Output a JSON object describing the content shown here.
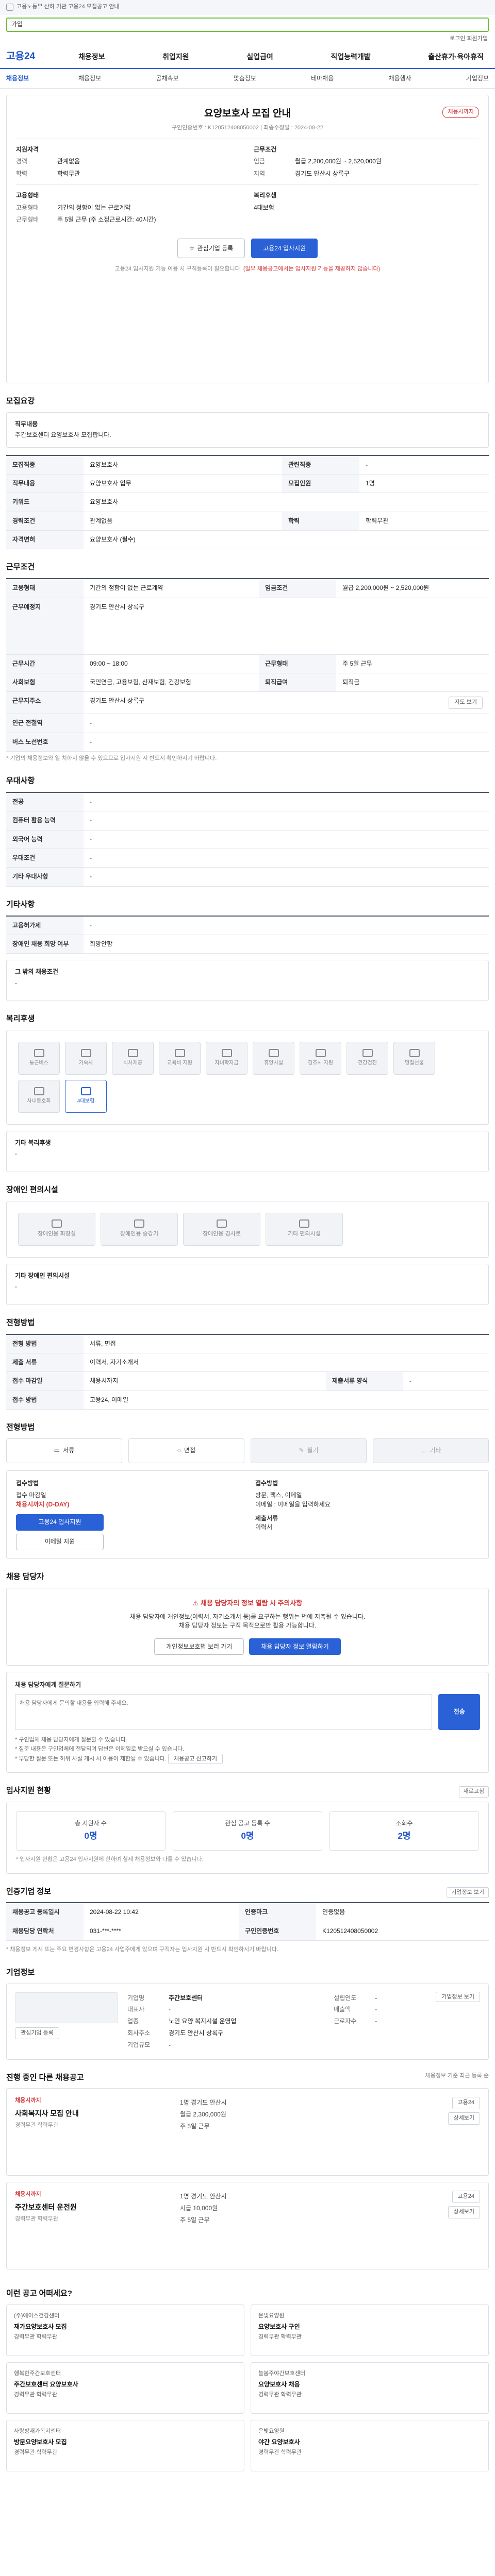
{
  "util": {
    "text": "고용노동부 산하 기관 고용24 모집공고 안내"
  },
  "search": {
    "keyword": "가입"
  },
  "login": {
    "links": "로그인  회원가입"
  },
  "gnb": {
    "logo": "고용24",
    "items": [
      "채용정보",
      "취업지원",
      "실업급여",
      "직업능력개발",
      "출산휴가·육아휴직"
    ]
  },
  "subnav": {
    "current": "채용정보",
    "items": [
      "채용정보",
      "공채속보",
      "맞춤정보",
      "테마채용",
      "채용행사",
      "기업정보"
    ]
  },
  "hero": {
    "title": "요양보호사 모집 안내",
    "badge": "채용시까지",
    "meta": "구인인증번호 : K120512408050002  |  최종수정일 : 2024-08-22",
    "recruit_head": "지원자격",
    "company_head": "근무조건",
    "left": [
      {
        "k": "경력",
        "v": "관계없음"
      },
      {
        "k": "학력",
        "v": "학력무관"
      }
    ],
    "right": [
      {
        "k": "임금",
        "v": "월급 2,200,000원 ~ 2,520,000원"
      },
      {
        "k": "지역",
        "v": "경기도 안산시 상록구"
      }
    ],
    "form_head": "고용형태",
    "form_items": [
      {
        "k": "고용형태",
        "v": "기간의 정함이 없는 근로계약"
      },
      {
        "k": "근무형태",
        "v": "주 5일 근무 (주 소정근로시간: 40시간)"
      }
    ],
    "right2_head": "복리후생",
    "right2_v": "4대보험",
    "btn_interest": "관심기업 등록",
    "btn_apply": "고용24 입사지원",
    "note": "고용24 입사지원 기능 이용 시 구직등록이 필요합니다.",
    "note_red": "(일부 채용공고에서는 입사지원 기능을 제공하지 않습니다)"
  },
  "duty": {
    "title": "모집요강",
    "label": "직무내용",
    "text": "주간보호센터 요양보호사 모집합니다."
  },
  "recruit_table": {
    "rows": [
      {
        "k": "모집직종",
        "v": "요양보호사",
        "k2": "관련직종",
        "v2": "-"
      },
      {
        "k": "직무내용",
        "v": "요양보호사 업무",
        "k2": "모집인원",
        "v2": "1명"
      },
      {
        "k": "키워드",
        "v": "요양보호사",
        "k2": "",
        "v2": ""
      },
      {
        "k": "경력조건",
        "v": "관계없음",
        "k2": "학력",
        "v2": "학력무관"
      },
      {
        "k": "자격면허",
        "v": "요양보호사 (필수)",
        "k2": "",
        "v2": ""
      }
    ]
  },
  "work": {
    "title": "근무조건",
    "rows": [
      {
        "k": "고용형태",
        "v": "기간의 정함이 없는 근로계약",
        "k2": "임금조건",
        "v2": "월급 2,200,000원 ~ 2,520,000원"
      },
      {
        "k": "근무예정지",
        "v": "경기도 안산시 상록구",
        "k2": "",
        "v2": ""
      },
      {
        "k": "근무시간",
        "v": "09:00 ~ 18:00",
        "k2": "근무형태",
        "v2": "주 5일 근무"
      },
      {
        "k": "사회보험",
        "v": "국민연금, 고용보험, 산재보험, 건강보험",
        "k2": "퇴직급여",
        "v2": "퇴직금"
      },
      {
        "k": "근무지주소",
        "v": "경기도 안산시 상록구",
        "k2": "",
        "v2": ""
      },
      {
        "k": "인근 전철역",
        "v": "-",
        "k2": "",
        "v2": ""
      },
      {
        "k": "버스 노선번호",
        "v": "-",
        "k2": "",
        "v2": ""
      }
    ],
    "map_btn": "지도 보기",
    "footnote": "* 기업의 채용정보와 일 치하지 않을 수 있으므로 입사지원 시 반드시 확인하시기 바랍니다."
  },
  "disability": {
    "title": "우대사항",
    "rows": [
      {
        "k": "전공",
        "v": "-"
      },
      {
        "k": "컴퓨터 활용 능력",
        "v": "-"
      },
      {
        "k": "외국어 능력",
        "v": "-"
      },
      {
        "k": "우대조건",
        "v": "-"
      },
      {
        "k": "기타 우대사항",
        "v": "-"
      }
    ]
  },
  "etc": {
    "title": "기타사항",
    "rows": [
      {
        "k": "고용허가제",
        "v": "-"
      },
      {
        "k": "장애인 채용 희망 여부",
        "v": "희망안함"
      }
    ],
    "extra_label": "그 밖의 채용조건",
    "extra_v": "-"
  },
  "welfare": {
    "title": "복리후생",
    "tags": [
      "통근버스",
      "기숙사",
      "식사제공",
      "교육비 지원",
      "자녀학자금",
      "휴양시설",
      "경조사 지원",
      "건강검진",
      "명절선물",
      "사내동호회"
    ],
    "on": "4대보험",
    "extra_label": "기타 복리후생",
    "extra_v": "-"
  },
  "disab_env": {
    "title": "장애인 편의시설",
    "tags": [
      "장애인용 화장실",
      "장애인용 승강기",
      "장애인용 경사로",
      "기타 편의시설"
    ],
    "extra_label": "기타 장애인 편의시설",
    "extra_v": "-"
  },
  "process": {
    "title": "전형방법",
    "rows": [
      {
        "k": "전형 방법",
        "v": "서류, 면접"
      },
      {
        "k": "제출 서류",
        "v": "이력서, 자기소개서"
      },
      {
        "k": "접수 마감일",
        "v": "채용시까지",
        "k2": "제출서류 양식",
        "v2": "-"
      },
      {
        "k": "접수 방법",
        "v": "고용24, 이메일",
        "k2": "",
        "v2": ""
      }
    ]
  },
  "methods": {
    "title": "전형방법",
    "items": [
      "서류",
      "면접",
      "필기",
      "기타"
    ]
  },
  "apply": {
    "left_head": "접수방법",
    "deadline_label": "접수 마감일",
    "deadline": "채용시까지 (D-DAY)",
    "apply_btn": "고용24 입사지원",
    "email_btn": "이메일 지원",
    "right_head": "접수방법",
    "right_lines": [
      "방문, 팩스, 이메일",
      "이메일 : 이메일을 입력하세요",
      "제출서류",
      "이력서"
    ]
  },
  "qa": {
    "title": "채용 담당자",
    "warn": "채용 담당자의 정보 열람 시 주의사항",
    "text1": "채용 담당자에 개인정보(이력서, 자기소개서 등)를 요구하는 행위는 법에 저촉될 수 있습니다.",
    "text2": "채용 담당자 정보는 구직 목적으로만 활용 가능합니다.",
    "btn_left": "개인정보보호법 보러 가기",
    "btn_right": "채용 담당자 정보 열람하기",
    "input_label": "채용 담당자에게 질문하기",
    "input_ph": "채용 담당자에게 문의할 내용을 입력해 주세요.",
    "send": "전송",
    "bullets": [
      "* 구인업체 채용 담당자에게 질문할 수 있습니다.",
      "* 질문 내용은 구인업체에 전달되며 답변은 이메일로 받으실 수 있습니다.",
      "* 부당한 질문 또는 허위 사실 게시 시 이용이 제한될 수 있습니다."
    ],
    "report_btn": "채용공고 신고하기"
  },
  "stats": {
    "title": "입사지원 현황",
    "more": "새로고침",
    "items": [
      {
        "label": "총 지원자 수",
        "value": "0명"
      },
      {
        "label": "관심 공고 등록 수",
        "value": "0명"
      },
      {
        "label": "조회수",
        "value": "2명"
      }
    ],
    "note": "* 입사지원 현황은 고용24 입사지원에 한하며 실제 채용정보와 다를 수 있습니다."
  },
  "bizinfo": {
    "title": "인증기업 정보",
    "more": "기업정보 보기",
    "rows": [
      {
        "k": "채용공고 등록일시",
        "v": "2024-08-22 10:42",
        "k2": "인증마크",
        "v2": "인증없음"
      },
      {
        "k": "채용담당 연락처",
        "v": "031-***-****",
        "k2": "구인인증번호",
        "v2": "K120512408050002"
      }
    ],
    "note": "* 채용정보 게시 또는 주요 변경사항은 고용24 사업주에게 있으며 구직자는 입사지원 시 반드시 확인하시기 바랍니다."
  },
  "company": {
    "title": "기업정보",
    "name_label": "기업명",
    "name": "주간보호센터",
    "rows": [
      {
        "k": "대표자",
        "v": "-"
      },
      {
        "k": "업종",
        "v": "노인 요양 복지시설 운영업"
      },
      {
        "k": "회사주소",
        "v": "경기도 안산시 상록구"
      },
      {
        "k": "기업규모",
        "v": "-"
      }
    ],
    "right_rows": [
      {
        "k": "설립연도",
        "v": "-"
      },
      {
        "k": "매출액",
        "v": "-"
      },
      {
        "k": "근로자수",
        "v": "-"
      }
    ],
    "btn_interest": "관심기업 등록",
    "btn_more": "기업정보 보기"
  },
  "other_jobs": {
    "title": "진행 중인 다른 채용공고",
    "note": "채용정보 기준 최근 등록 순",
    "items": [
      {
        "co": "채용시까지",
        "title": "사회복지사 모집 안내",
        "tags": "경력무관  학력무관",
        "l1": "1명  경기도 안산시",
        "l2": "월급 2,300,000원",
        "l3": "주 5일 근무"
      },
      {
        "co": "채용시까지",
        "title": "주간보호센터 운전원",
        "tags": "경력무관  학력무관",
        "l1": "1명  경기도 안산시",
        "l2": "시급 10,000원",
        "l3": "주 5일 근무"
      }
    ],
    "btn1": "고용24",
    "btn2": "상세보기"
  },
  "similar": {
    "title": "이런 공고 어떠세요?",
    "items": [
      {
        "co": "(주)에이스건강센터",
        "title": "재가요양보호사 모집",
        "meta": "경력무관  학력무관"
      },
      {
        "co": "온빛요양원",
        "title": "요양보호사 구인",
        "meta": "경력무관  학력무관"
      },
      {
        "co": "행복한주간보호센터",
        "title": "주간보호센터 요양보호사",
        "meta": "경력무관  학력무관"
      },
      {
        "co": "늘봄주야간보호센터",
        "title": "요양보호사 채용",
        "meta": "경력무관  학력무관"
      },
      {
        "co": "사랑방재가복지센터",
        "title": "방문요양보호사 모집",
        "meta": "경력무관  학력무관"
      },
      {
        "co": "은빛요양원",
        "title": "야간 요양보호사",
        "meta": "경력무관  학력무관"
      }
    ]
  }
}
